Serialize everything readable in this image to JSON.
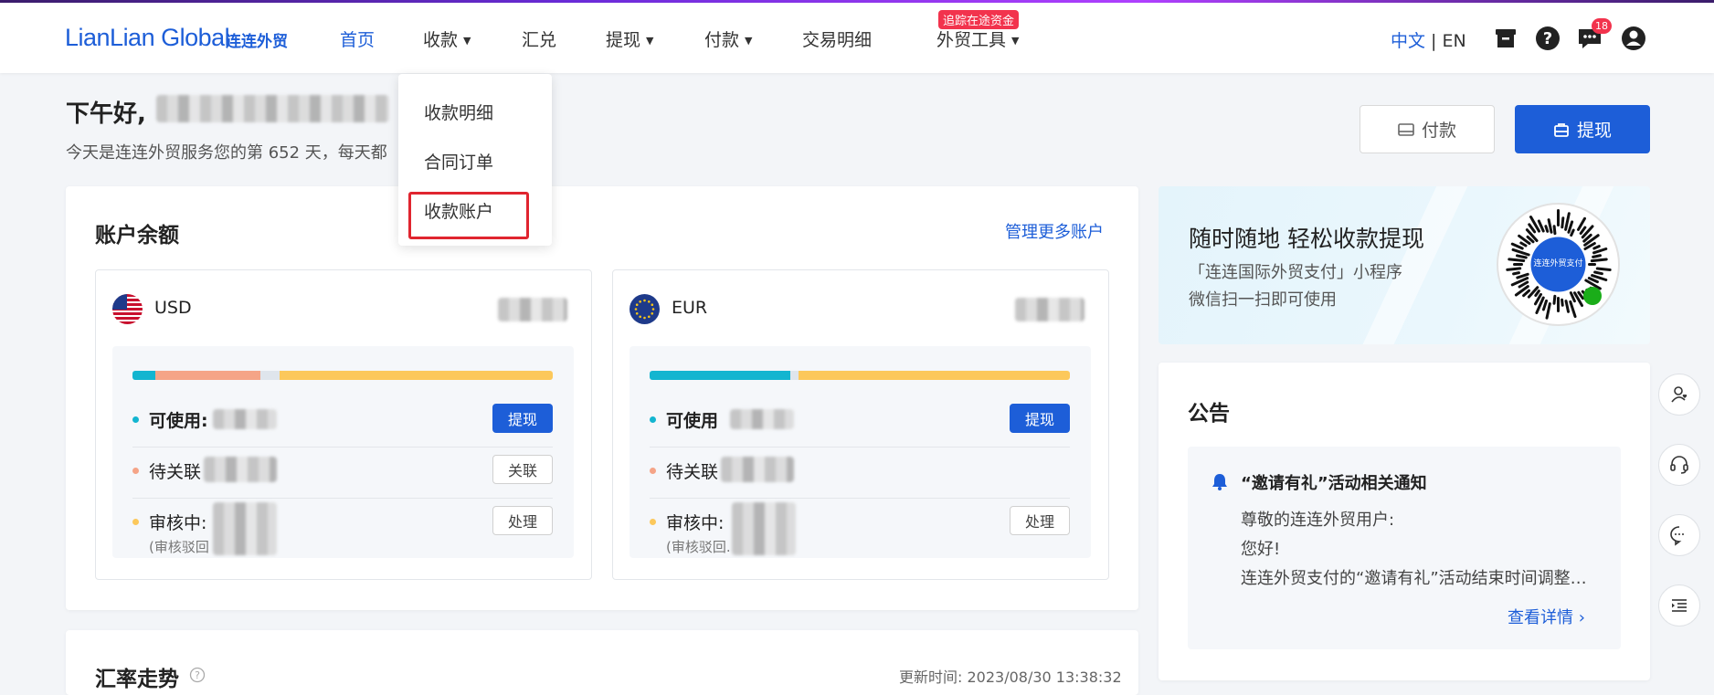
{
  "header": {
    "logo_en": "LianLian Global",
    "logo_cn": "连连外贸",
    "nav": [
      {
        "label": "首页"
      },
      {
        "label": "收款"
      },
      {
        "label": "汇兑"
      },
      {
        "label": "提现"
      },
      {
        "label": "付款"
      },
      {
        "label": "交易明细"
      },
      {
        "label": "外贸工具"
      }
    ],
    "promo_badge": "追踪在途资金",
    "lang_zh": "中文",
    "lang_sep": " | ",
    "lang_en": "EN",
    "message_count": "18"
  },
  "greeting": {
    "title": "下午好,",
    "subtitle": "今天是连连外贸服务您的第 652 天，每天都"
  },
  "actions": {
    "pay": "付款",
    "withdraw": "提现"
  },
  "dropdown": {
    "items": [
      "收款明细",
      "合同订单",
      "收款账户"
    ]
  },
  "balance": {
    "title": "账户余额",
    "manage_link": "管理更多账户",
    "accounts": [
      {
        "currency": "USD",
        "bar": [
          {
            "fraction": 0.055,
            "color": "#13b5d0"
          },
          {
            "fraction": 0.25,
            "color": "#f5a487"
          },
          {
            "fraction": 0.045,
            "color": "#dfe5ec"
          },
          {
            "fraction": 0.65,
            "color": "#fcc85b"
          }
        ],
        "available_label": "可使用:",
        "available_btn": "提现",
        "pending_label": "待关联",
        "pending_btn": "关联",
        "review_label": "审核中:",
        "review_sub": "(审核驳回",
        "review_btn": "处理"
      },
      {
        "currency": "EUR",
        "bar": [
          {
            "fraction": 0.335,
            "color": "#13b5d0"
          },
          {
            "fraction": 0.02,
            "color": "#dfe5ec"
          },
          {
            "fraction": 0.645,
            "color": "#fcc85b"
          }
        ],
        "available_label": "可使用",
        "available_btn": "提现",
        "pending_label": "待关联",
        "pending_btn": "关联",
        "review_label": "审核中:",
        "review_sub": "(审核驳回.",
        "review_btn": "处理"
      }
    ]
  },
  "promo": {
    "title": "随时随地 轻松收款提现",
    "line1": "「连连国际外贸支付」小程序",
    "line2": "微信扫一扫即可使用",
    "qr_label": "连连外贸支付"
  },
  "notice": {
    "title": "公告",
    "item_title": "“邀请有礼”活动相关通知",
    "line1": "尊敬的连连外贸用户:",
    "line2": "您好!",
    "line3": "连连外贸支付的“邀请有礼”活动结束时间调整…",
    "more": "查看详情"
  },
  "rate": {
    "title": "汇率走势",
    "updated_label": "更新时间:",
    "updated_time": "2023/08/30 13:38:32"
  },
  "colors": {
    "brand": "#1d5ed8",
    "danger": "#e0252f"
  }
}
